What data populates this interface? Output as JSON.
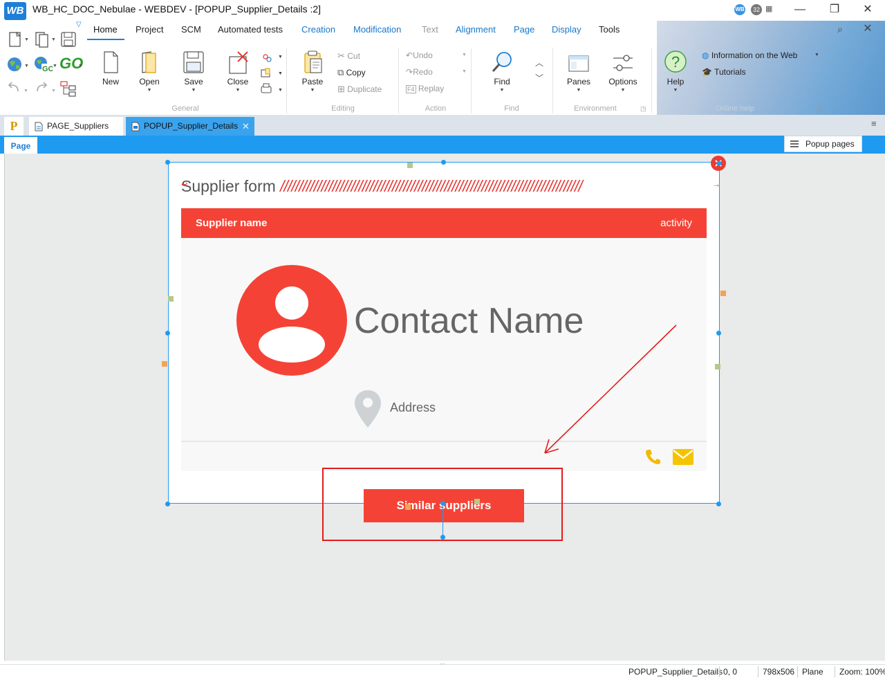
{
  "titlebar": {
    "logo": "WB",
    "title": "WB_HC_DOC_Nebulae - WEBDEV - [POPUP_Supplier_Details :2]",
    "badge_wb": "WB",
    "badge_count": "32",
    "minimize": "—",
    "restore": "❐",
    "close": "✕",
    "sub_search": "⌕",
    "sub_close": "✕"
  },
  "menu": {
    "tabs": [
      {
        "label": "Home"
      },
      {
        "label": "Project"
      },
      {
        "label": "SCM"
      },
      {
        "label": "Automated tests"
      },
      {
        "label": "Creation"
      },
      {
        "label": "Modification"
      },
      {
        "label": "Text"
      },
      {
        "label": "Alignment"
      },
      {
        "label": "Page"
      },
      {
        "label": "Display"
      },
      {
        "label": "Tools"
      }
    ]
  },
  "ribbon": {
    "general": {
      "new": "New",
      "open": "Open",
      "save": "Save",
      "close": "Close",
      "label": "General"
    },
    "editing": {
      "paste": "Paste",
      "cut": "Cut",
      "copy": "Copy",
      "duplicate": "Duplicate",
      "label": "Editing"
    },
    "action": {
      "undo": "Undo",
      "redo": "Redo",
      "replay": "Replay",
      "label": "Action"
    },
    "find": {
      "find": "Find",
      "label": "Find"
    },
    "environment": {
      "panes": "Panes",
      "options": "Options",
      "label": "Environment"
    },
    "help": {
      "help": "Help",
      "info_web": "Information on the Web",
      "tutorials": "Tutorials",
      "label": "Online help"
    }
  },
  "doc_tabs": [
    {
      "label": "PAGE_Suppliers"
    },
    {
      "label": "POPUP_Supplier_Details"
    }
  ],
  "pagebar": {
    "page_tab": "Page",
    "popup_pages": "Popup pages"
  },
  "popup": {
    "title": "Supplier form",
    "slashes": "/////////////////////////////////////////////////////////////////////////////////",
    "supplier_name": "Supplier name",
    "activity": "activity",
    "contact_name": "Contact Name",
    "address": "Address",
    "similar_suppliers": "Similar suppliers"
  },
  "statusbar": {
    "element": "POPUP_Supplier_Details",
    "position": "0, 0",
    "size": "798x506",
    "plane": "Plane",
    "zoom": "Zoom: 100%"
  },
  "colors": {
    "accent_red": "#f44336",
    "accent_blue": "#1e9bf0",
    "phone_icon": "#f5b800",
    "mail_icon": "#f5c400"
  }
}
